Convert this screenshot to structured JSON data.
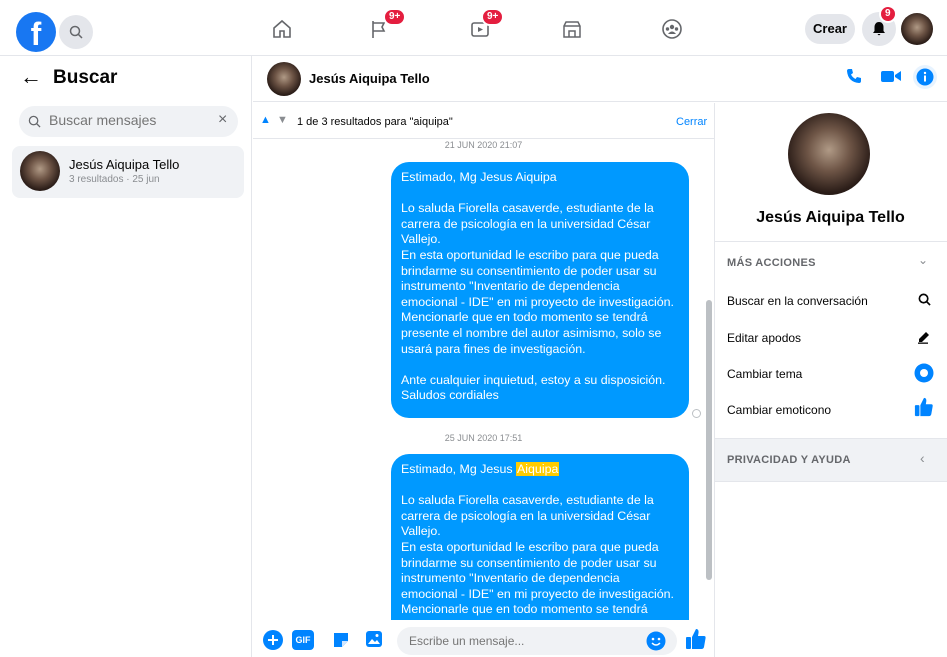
{
  "topnav": {
    "logo": "f",
    "badges": {
      "flag": "9+",
      "video": "9+",
      "notifications": "9"
    },
    "create_label": "Crear",
    "icons": [
      "search-icon",
      "home-icon",
      "flag-icon",
      "video-icon",
      "marketplace-icon",
      "groups-icon",
      "bell-icon"
    ]
  },
  "left": {
    "title": "Buscar",
    "search_placeholder": "Buscar mensajes",
    "results": [
      {
        "name": "Jesús Aiquipa Tello",
        "meta": "3 resultados · 25 jun"
      }
    ]
  },
  "chat": {
    "name": "Jesús Aiquipa Tello",
    "search_status": "1 de 3 resultados para \"aiquipa\"",
    "close_label": "Cerrar",
    "messages": [
      {
        "date": "21 JUN 2020 21:07",
        "text": "Estimado, Mg Jesus Aiquipa\n\nLo saluda Fiorella casaverde, estudiante de la carrera de psicología en la universidad César Vallejo.\nEn esta oportunidad le escribo para que pueda brindarme su consentimiento de poder usar su instrumento \"Inventario de dependencia emocional - IDE\" en mi proyecto de investigación.\nMencionarle que en todo momento se tendrá presente el nombre del autor asimismo, solo se usará para fines de investigación.\n\nAnte cualquier inquietud, estoy a su disposición.\nSaludos cordiales"
      },
      {
        "date": "25 JUN 2020 17:51",
        "greeting_prefix": "Estimado, Mg Jesus ",
        "highlight": "Aiquipa",
        "text": "Lo saluda Fiorella casaverde, estudiante de la carrera de psicología en la universidad César Vallejo.\nEn esta oportunidad le escribo para que pueda brindarme su consentimiento de poder usar su instrumento \"Inventario de dependencia emocional - IDE\" en mi proyecto de investigación.\nMencionarle que en todo momento se tendrá"
      }
    ],
    "composer_placeholder": "Escribe un mensaje...",
    "gif_label": "GIF"
  },
  "right": {
    "name": "Jesús Aiquipa Tello",
    "more_actions_title": "MÁS ACCIONES",
    "actions": [
      {
        "label": "Buscar en la conversación"
      },
      {
        "label": "Editar apodos"
      },
      {
        "label": "Cambiar tema"
      },
      {
        "label": "Cambiar emoticono"
      }
    ],
    "privacy_title": "PRIVACIDAD Y AYUDA"
  },
  "colors": {
    "accent": "#0084ff",
    "bubble": "#0099ff",
    "badge": "#e41e3f",
    "highlight": "#ffcc00"
  }
}
